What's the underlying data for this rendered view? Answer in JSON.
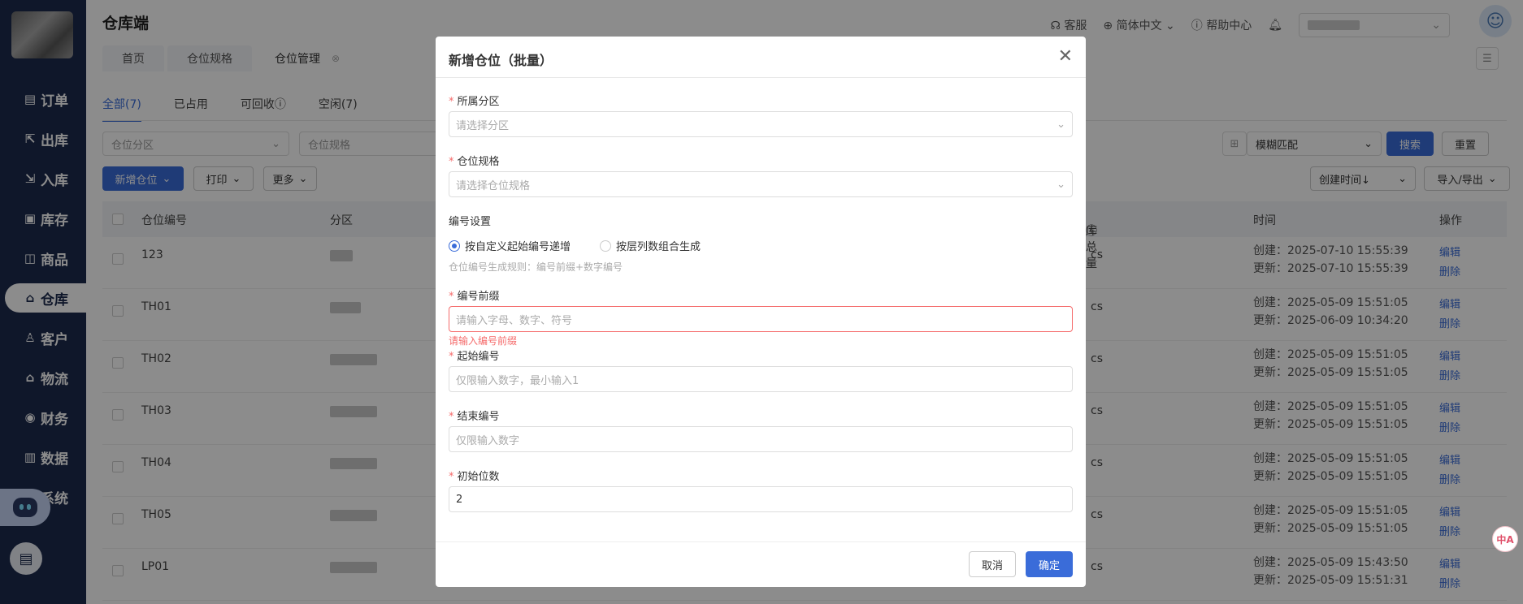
{
  "sidebar": {
    "items": [
      {
        "icon": "order-icon",
        "label": "订单"
      },
      {
        "icon": "outbound-icon",
        "label": "出库"
      },
      {
        "icon": "inbound-icon",
        "label": "入库"
      },
      {
        "icon": "inventory-icon",
        "label": "库存"
      },
      {
        "icon": "goods-icon",
        "label": "商品"
      },
      {
        "icon": "warehouse-icon",
        "label": "仓库"
      },
      {
        "icon": "customer-icon",
        "label": "客户"
      },
      {
        "icon": "logistics-icon",
        "label": "物流"
      },
      {
        "icon": "finance-icon",
        "label": "财务"
      },
      {
        "icon": "data-icon",
        "label": "数据"
      },
      {
        "icon": "system-icon",
        "label": "系统"
      }
    ]
  },
  "header": {
    "title": "仓库端",
    "service": "客服",
    "language": "简体中文",
    "help": "帮助中心"
  },
  "tabs": [
    "首页",
    "仓位规格",
    "仓位管理"
  ],
  "subtabs": [
    "全部(7)",
    "已占用",
    "可回收",
    "空闲(7)"
  ],
  "filters": {
    "zone_placeholder": "仓位分区",
    "spec_placeholder": "仓位规格",
    "match": "模糊匹配",
    "search": "搜索",
    "reset": "重置",
    "sort": "创建时间"
  },
  "toolbar": {
    "add": "新增仓位",
    "print": "打印",
    "more": "更多",
    "io": "导入/导出"
  },
  "table": {
    "headers": [
      "仓位编号",
      "分区",
      "库总量",
      "时间",
      "操作"
    ],
    "rows": [
      {
        "code": "123",
        "unit": "cs",
        "created": "创建：2025-07-10 15:55:39",
        "updated": "更新：2025-07-10 15:55:39"
      },
      {
        "code": "TH01",
        "unit": "cs",
        "created": "创建：2025-05-09 15:51:05",
        "updated": "更新：2025-06-09 10:34:20"
      },
      {
        "code": "TH02",
        "unit": "cs",
        "created": "创建：2025-05-09 15:51:05",
        "updated": "更新：2025-05-09 15:51:05"
      },
      {
        "code": "TH03",
        "unit": "cs",
        "created": "创建：2025-05-09 15:51:05",
        "updated": "更新：2025-05-09 15:51:05"
      },
      {
        "code": "TH04",
        "unit": "cs",
        "created": "创建：2025-05-09 15:51:05",
        "updated": "更新：2025-05-09 15:51:05"
      },
      {
        "code": "TH05",
        "unit": "cs",
        "created": "创建：2025-05-09 15:51:05",
        "updated": "更新：2025-05-09 15:51:05"
      },
      {
        "code": "LP01",
        "unit": "cs",
        "created": "创建：2025-05-09 15:43:50",
        "updated": "更新：2025-05-09 15:51:31"
      }
    ],
    "edit": "编辑",
    "delete": "删除"
  },
  "modal": {
    "title": "新增仓位（批量）",
    "zone_label": "所属分区",
    "zone_placeholder": "请选择分区",
    "spec_label": "仓位规格",
    "spec_placeholder": "请选择仓位规格",
    "numbering_label": "编号设置",
    "radio_custom": "按自定义起始编号递增",
    "radio_layer": "按层列数组合生成",
    "rule_hint": "仓位编号生成规则：编号前缀+数字编号",
    "prefix_label": "编号前缀",
    "prefix_placeholder": "请输入字母、数字、符号",
    "prefix_error": "请输入编号前缀",
    "start_label": "起始编号",
    "start_placeholder": "仅限输入数字，最小输入1",
    "end_label": "结束编号",
    "end_placeholder": "仅限输入数字",
    "digits_label": "初始位数",
    "digits_value": "2",
    "cancel": "取消",
    "confirm": "确定"
  },
  "colors": {
    "primary": "#3a6cd9",
    "sidebar": "#1d2b4e",
    "error": "#f56c6c"
  }
}
